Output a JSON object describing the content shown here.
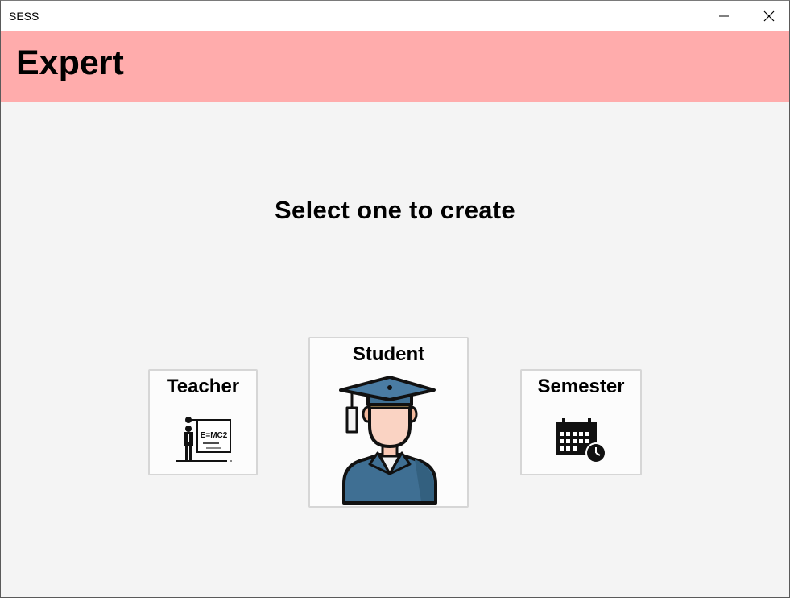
{
  "window": {
    "title": "SESS",
    "controls": {
      "minimize_icon": "minimize-icon",
      "close_icon": "close-icon"
    }
  },
  "header": {
    "title": "Expert",
    "background_color": "#ffacac"
  },
  "main": {
    "prompt": "Select one to create",
    "options": [
      {
        "label": "Teacher",
        "icon": "teacher-blackboard-icon"
      },
      {
        "label": "Student",
        "icon": "graduate-student-icon"
      },
      {
        "label": "Semester",
        "icon": "calendar-clock-icon"
      }
    ],
    "teacher_board_text": "E=MC2"
  }
}
